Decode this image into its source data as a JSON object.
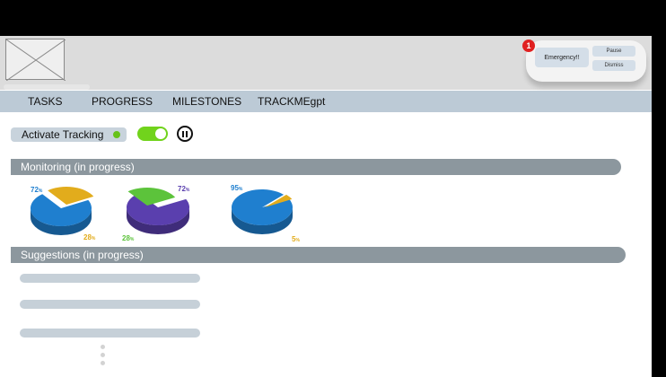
{
  "header": {
    "logo": "image-placeholder-icon",
    "notification": {
      "badge_count": "1",
      "message": "Emergency!!",
      "pause_label": "Pause",
      "dismiss_label": "Dismiss",
      "badge_color": "#e02020"
    }
  },
  "nav": {
    "items": [
      {
        "label": "TASKS"
      },
      {
        "label": "PROGRESS"
      },
      {
        "label": "MILESTONES"
      },
      {
        "label": "TRACKMEgpt"
      }
    ]
  },
  "tracking": {
    "label": "Activate Tracking",
    "enabled": true,
    "toggle_color": "#71d31c",
    "pause_icon": "pause-circle-icon"
  },
  "monitoring": {
    "title": "Monitoring (in progress)",
    "charts": [
      {
        "slices": [
          {
            "value": 72,
            "label": "72",
            "color": "#1f7fcf"
          },
          {
            "value": 28,
            "label": "28",
            "color": "#e2ac1c"
          }
        ]
      },
      {
        "slices": [
          {
            "value": 72,
            "label": "72",
            "color": "#5a3fae"
          },
          {
            "value": 28,
            "label": "28",
            "color": "#5cc33b"
          }
        ]
      },
      {
        "slices": [
          {
            "value": 95,
            "label": "95",
            "color": "#1f7fcf"
          },
          {
            "value": 5,
            "label": "5",
            "color": "#e2ac1c"
          }
        ]
      }
    ],
    "unit": "%"
  },
  "suggestions": {
    "title": "Suggestions (in progress)",
    "items": 3,
    "more_icon": "vertical-ellipsis-icon"
  }
}
